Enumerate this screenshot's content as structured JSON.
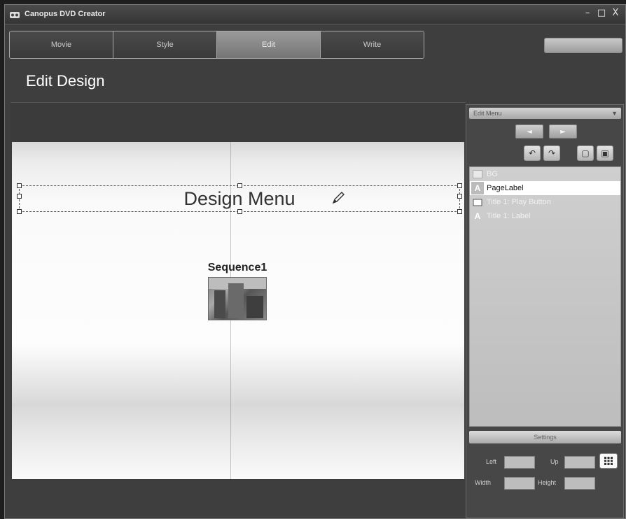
{
  "window": {
    "title": "Canopus DVD Creator",
    "controls": {
      "minimize": "–",
      "maximize": "□",
      "close": "X"
    }
  },
  "steps": [
    {
      "label": "Movie",
      "active": false
    },
    {
      "label": "Style",
      "active": false
    },
    {
      "label": "Edit",
      "active": true
    },
    {
      "label": "Write",
      "active": false
    }
  ],
  "page": {
    "title": "Edit Design"
  },
  "canvas": {
    "menu_label": "Design Menu",
    "sequence_title": "Sequence1"
  },
  "panel": {
    "header": "Edit Menu",
    "prev_icon": "◄",
    "next_icon": "►",
    "tools": [
      {
        "icon": "undo-icon",
        "glyph": "↶"
      },
      {
        "icon": "redo-icon",
        "glyph": "↷"
      },
      {
        "icon": "frame-icon",
        "glyph": "▢"
      },
      {
        "icon": "safe-area-icon",
        "glyph": "▣"
      }
    ],
    "layers": [
      {
        "label": "BG",
        "icon": "background",
        "selected": false
      },
      {
        "label": "PageLabel",
        "icon": "text",
        "selected": true
      },
      {
        "label": "Title 1: Play Button",
        "icon": "button",
        "selected": false
      },
      {
        "label": "Title 1: Label",
        "icon": "text",
        "selected": false
      }
    ],
    "settings": {
      "header": "Settings",
      "left_label": "Left",
      "up_label": "Up",
      "width_label": "Width",
      "height_label": "Height",
      "left_value": "",
      "up_value": "",
      "width_value": "",
      "height_value": ""
    }
  },
  "colors": {
    "background": "#3e3e3e",
    "active_tab": "#8a8a8a",
    "selection": "#ffffff"
  }
}
